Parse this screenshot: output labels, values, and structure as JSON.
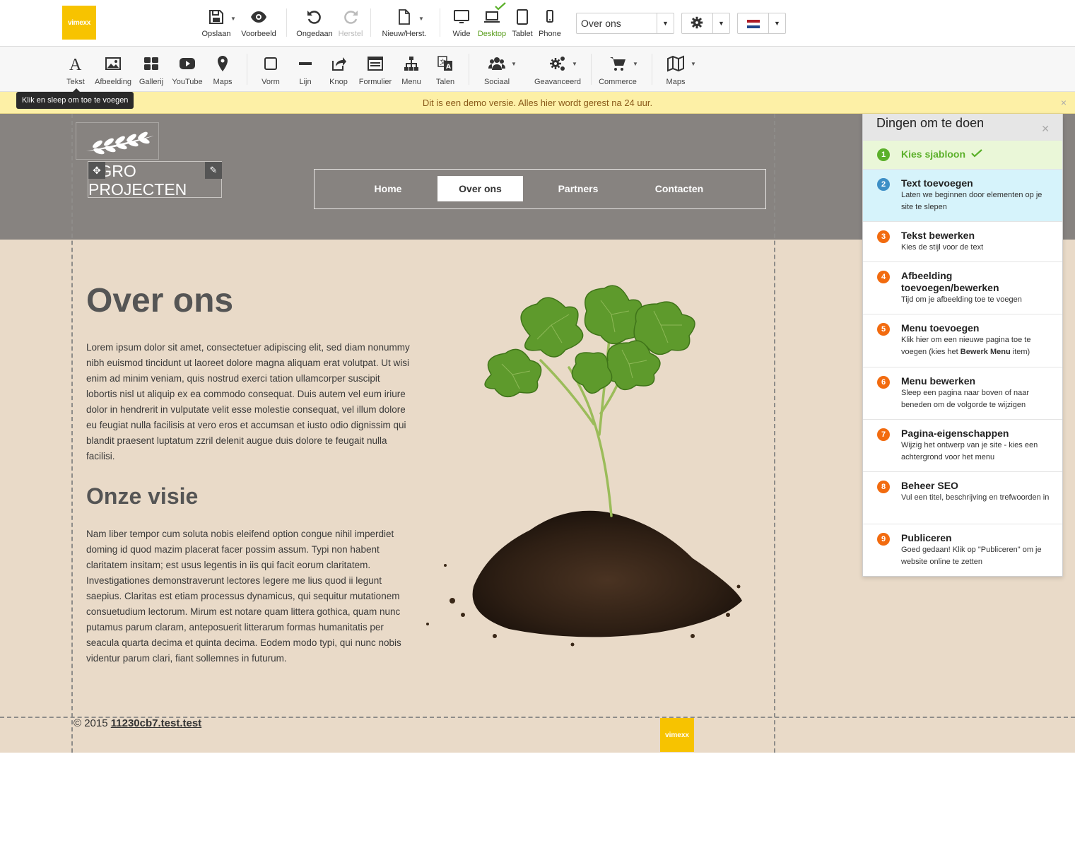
{
  "app": {
    "logo_text": "vimexx"
  },
  "topbar": {
    "save": "Opslaan",
    "preview": "Voorbeeld",
    "undo": "Ongedaan",
    "redo": "Herstel",
    "new_restore": "Nieuw/Herst.",
    "wide": "Wide",
    "desktop": "Desktop",
    "tablet": "Tablet",
    "phone": "Phone",
    "page_select": "Over ons"
  },
  "tools": {
    "text": "Tekst",
    "image": "Afbeelding",
    "gallery": "Gallerij",
    "youtube": "YouTube",
    "maps": "Maps",
    "shape": "Vorm",
    "line": "Lijn",
    "button": "Knop",
    "form": "Formulier",
    "menu": "Menu",
    "languages": "Talen",
    "social": "Sociaal",
    "advanced": "Geavanceerd",
    "commerce": "Commerce",
    "maps2": "Maps"
  },
  "notice": {
    "text": "Dit is een demo versie. Alles hier wordt gerest na 24 uur.",
    "close": "×"
  },
  "tooltip": "Klik en sleep om toe te voegen",
  "site": {
    "brand": "AGRO PROJECTEN",
    "nav": [
      "Home",
      "Over ons",
      "Partners",
      "Contacten"
    ],
    "heading": "Over ons",
    "paragraph1": "Lorem ipsum dolor sit amet, consectetuer adipiscing elit, sed diam nonummy nibh euismod tincidunt ut laoreet dolore magna aliquam erat volutpat. Ut wisi enim ad minim veniam, quis nostrud exerci tation ullamcorper suscipit lobortis nisl ut aliquip ex ea commodo consequat. Duis autem vel eum iriure dolor in hendrerit in vulputate velit esse molestie consequat, vel illum dolore eu feugiat nulla facilisis at vero eros et accumsan et iusto odio dignissim qui blandit praesent luptatum zzril delenit augue duis dolore te feugait nulla facilisi.",
    "subheading": "Onze visie",
    "paragraph2": "Nam liber tempor cum soluta nobis eleifend option congue nihil imperdiet doming id quod mazim placerat facer possim assum. Typi non habent claritatem insitam; est usus legentis in iis qui facit eorum claritatem. Investigationes demonstraverunt lectores legere me lius quod ii legunt saepius. Claritas est etiam processus dynamicus, qui sequitur mutationem consuetudium lectorum. Mirum est notare quam littera gothica, quam nunc putamus parum claram, anteposuerit litterarum formas humanitatis per seacula quarta decima et quinta decima. Eodem modo typi, qui nunc nobis videntur parum clari, fiant sollemnes in futurum.",
    "footer_copy": "© 2015",
    "footer_link": "11230cb7.test.test"
  },
  "todo": {
    "title": "Dingen om te doen",
    "items": [
      {
        "num": "1",
        "title": "Kies sjabloon",
        "desc": "",
        "color": "#5bb02a",
        "state": "done"
      },
      {
        "num": "2",
        "title": "Text toevoegen",
        "desc": "Laten we beginnen door elementen op je site te slepen",
        "color": "#3d8fc6",
        "state": "current"
      },
      {
        "num": "3",
        "title": "Tekst bewerken",
        "desc": "Kies de stijl voor de text",
        "color": "#f26b0f",
        "state": "todo"
      },
      {
        "num": "4",
        "title": "Afbeelding toevoegen/bewerken",
        "desc": "Tijd om je afbeelding toe te voegen",
        "color": "#f26b0f",
        "state": "todo"
      },
      {
        "num": "5",
        "title": "Menu toevoegen",
        "desc_pre": "Klik hier om een nieuwe pagina toe te voegen (kies het ",
        "desc_bold": "Bewerk Menu",
        "desc_post": " item)",
        "color": "#f26b0f",
        "state": "todo"
      },
      {
        "num": "6",
        "title": "Menu bewerken",
        "desc": "Sleep een pagina naar boven of naar beneden om de volgorde te wijzigen",
        "color": "#f26b0f",
        "state": "todo"
      },
      {
        "num": "7",
        "title": "Pagina-eigenschappen",
        "desc": "Wijzig het ontwerp van je site - kies een achtergrond voor het menu",
        "color": "#f26b0f",
        "state": "todo"
      },
      {
        "num": "8",
        "title": "Beheer SEO",
        "desc": "Vul een titel, beschrijving en trefwoorden in",
        "color": "#f26b0f",
        "state": "todo"
      },
      {
        "num": "9",
        "title": "Publiceren",
        "desc": "Goed gedaan! Klik op \"Publiceren\" om je website online te zetten",
        "color": "#f26b0f",
        "state": "todo"
      }
    ]
  }
}
